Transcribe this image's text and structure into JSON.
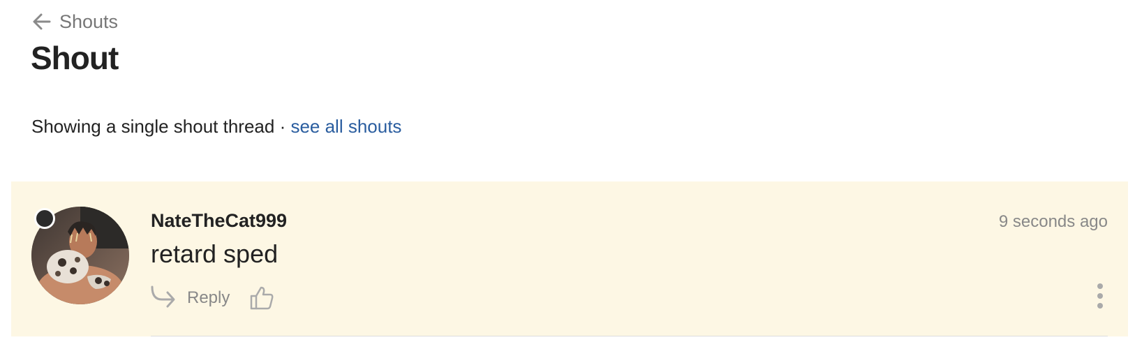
{
  "nav": {
    "back_label": "Shouts",
    "back_icon": "arrow-left-icon"
  },
  "page": {
    "title": "Shout"
  },
  "subtitle": {
    "text": "Showing a single shout thread · ",
    "link_label": "see all shouts"
  },
  "colors": {
    "card_background": "#fdf7e4",
    "link": "#2a5d9f",
    "muted_text": "#888888",
    "presence_dot": "#2b2b2b"
  },
  "shout": {
    "username": "NateTheCat999",
    "timestamp": "9 seconds ago",
    "message": "retard sped",
    "reply_label": "Reply",
    "reply_icon": "reply-arrow-icon",
    "like_icon": "thumbs-up-icon",
    "more_icon": "vertical-ellipsis-icon",
    "avatar": "user-avatar"
  }
}
